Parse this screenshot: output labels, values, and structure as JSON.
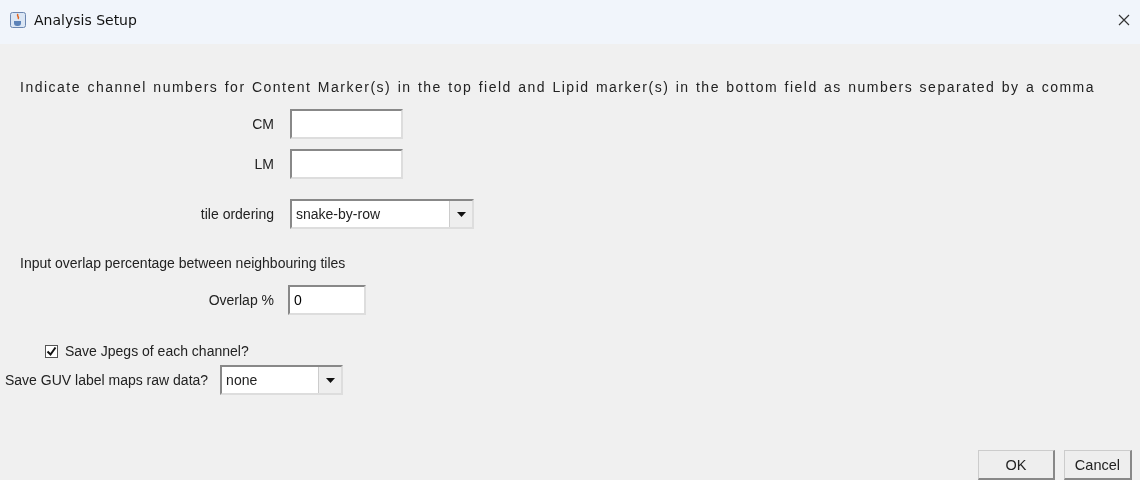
{
  "window": {
    "title": "Analysis Setup"
  },
  "instruction": "Indicate channel numbers for Content Marker(s) in the top field and Lipid marker(s) in the bottom field as numbers separated by a comma",
  "fields": [
    {
      "label": "CM"
    },
    {
      "label": "LM"
    }
  ],
  "tile_ordering": {
    "label": "tile ordering",
    "value": "snake-by-row"
  },
  "overlap_prompt": "Input overlap percentage between neighbouring tiles",
  "overlap": {
    "label": "Overlap %",
    "value": "0"
  },
  "save_jpegs": {
    "label": "Save Jpegs of each channel?",
    "checked": true
  },
  "raw_data": {
    "label": "Save GUV label maps raw data?",
    "value": "none"
  },
  "buttons": [
    "OK",
    "Cancel"
  ]
}
